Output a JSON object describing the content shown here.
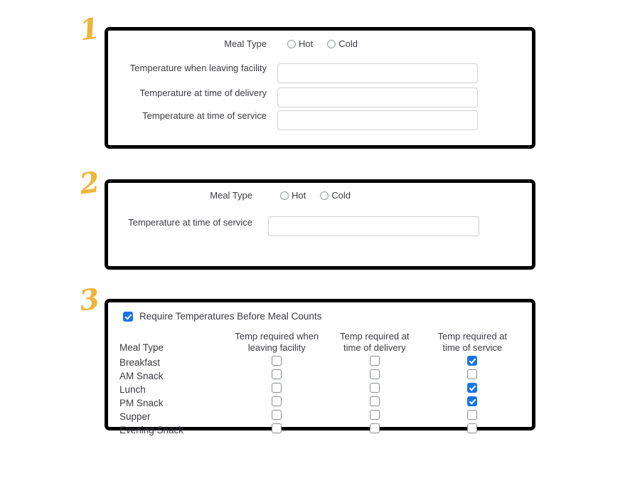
{
  "steps": {
    "one": "1",
    "two": "2",
    "three": "3"
  },
  "colors": {
    "step_number": "#eeb43a",
    "panel_border": "#000000",
    "checkbox_checked": "#1a73e8",
    "input_border": "#cfd0d2",
    "label_text": "#3b3b42"
  },
  "panel1": {
    "meal_type_label": "Meal Type",
    "radio_options": [
      {
        "label": "Hot",
        "checked": false
      },
      {
        "label": "Cold",
        "checked": false
      }
    ],
    "fields": [
      {
        "label": "Temperature when leaving facility",
        "value": "",
        "placeholder": ""
      },
      {
        "label": "Temperature at time of delivery",
        "value": "",
        "placeholder": ""
      },
      {
        "label": "Temperature at time of service",
        "value": "",
        "placeholder": ""
      }
    ]
  },
  "panel2": {
    "meal_type_label": "Meal Type",
    "radio_options": [
      {
        "label": "Hot",
        "checked": false
      },
      {
        "label": "Cold",
        "checked": false
      }
    ],
    "fields": [
      {
        "label": "Temperature at time of service",
        "value": "",
        "placeholder": ""
      }
    ]
  },
  "panel3": {
    "require_label": "Require Temperatures Before Meal Counts",
    "require_checked": true,
    "columns": [
      "Meal Type",
      "Temp required when leaving facility",
      "Temp required at time of delivery",
      "Temp required at time of service"
    ],
    "column_header_lines": [
      [
        "Meal Type"
      ],
      [
        "Temp required when",
        "leaving facility"
      ],
      [
        "Temp required at",
        "time of delivery"
      ],
      [
        "Temp required at",
        "time of service"
      ]
    ],
    "rows": [
      {
        "meal": "Breakfast",
        "leaving": false,
        "delivery": false,
        "service": true
      },
      {
        "meal": "AM Snack",
        "leaving": false,
        "delivery": false,
        "service": false
      },
      {
        "meal": "Lunch",
        "leaving": false,
        "delivery": false,
        "service": true
      },
      {
        "meal": "PM Snack",
        "leaving": false,
        "delivery": false,
        "service": true
      },
      {
        "meal": "Supper",
        "leaving": false,
        "delivery": false,
        "service": false
      },
      {
        "meal": "Evening Snack",
        "leaving": false,
        "delivery": false,
        "service": false
      }
    ]
  }
}
